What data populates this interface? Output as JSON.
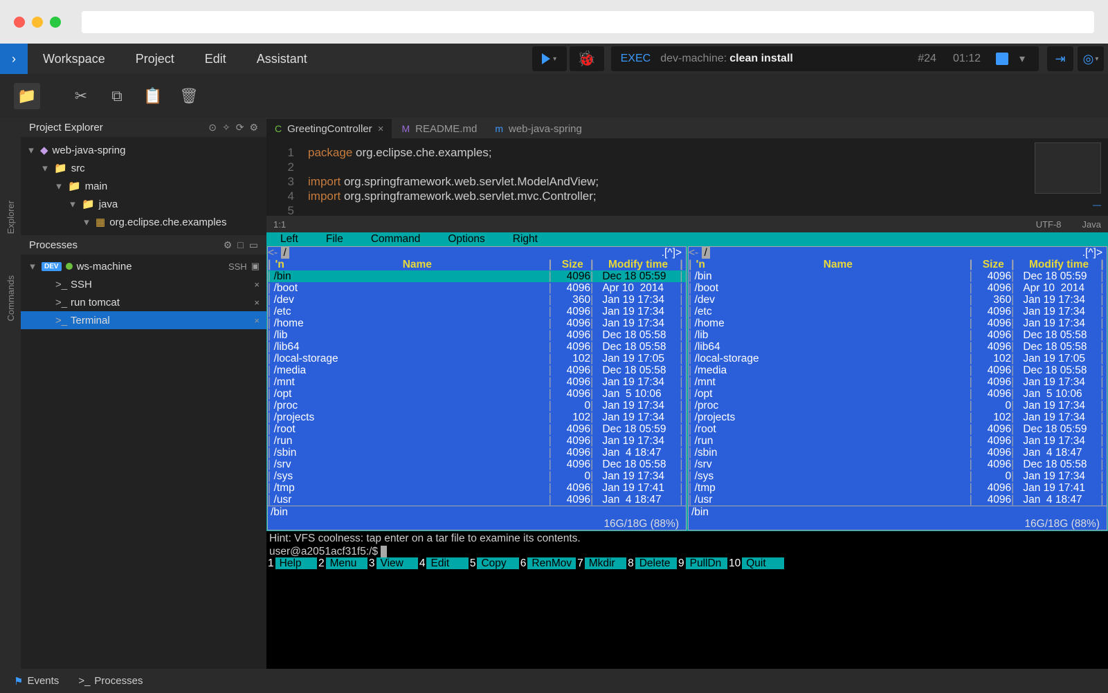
{
  "macBar": {
    "dots": [
      "#ff5f57",
      "#febc2e",
      "#28c840"
    ]
  },
  "menu": {
    "items": [
      "Workspace",
      "Project",
      "Edit",
      "Assistant"
    ]
  },
  "exec": {
    "label": "EXEC",
    "machine": "dev-machine:",
    "command": "clean install",
    "buildNumber": "#24",
    "time": "01:12"
  },
  "toolbar": {
    "buttons": [
      "new-file",
      "cut",
      "copy",
      "paste",
      "delete"
    ]
  },
  "leftRail": {
    "items": [
      "Explorer",
      "Commands"
    ]
  },
  "projectExplorer": {
    "title": "Project Explorer",
    "tree": [
      {
        "pad": 8,
        "icon": "project",
        "name": "web-java-spring"
      },
      {
        "pad": 28,
        "icon": "folder-y",
        "name": "src"
      },
      {
        "pad": 48,
        "icon": "folder-y",
        "name": "main"
      },
      {
        "pad": 68,
        "icon": "folder-b",
        "name": "java"
      },
      {
        "pad": 88,
        "icon": "package",
        "name": "org.eclipse.che.examples"
      }
    ]
  },
  "processes": {
    "title": "Processes",
    "machine": {
      "name": "ws-machine",
      "ssh": "SSH"
    },
    "items": [
      {
        "name": "SSH",
        "selected": false
      },
      {
        "name": "run tomcat",
        "selected": false
      },
      {
        "name": "Terminal",
        "selected": true
      }
    ]
  },
  "editor": {
    "tabs": [
      {
        "label": "GreetingController",
        "ico": "C",
        "icoColor": "#6dbf3f",
        "active": true,
        "close": true
      },
      {
        "label": "README.md",
        "ico": "M",
        "icoColor": "#9b6dd7",
        "active": false,
        "close": false
      },
      {
        "label": "web-java-spring",
        "ico": "m",
        "icoColor": "#3b99fc",
        "active": false,
        "close": false
      }
    ],
    "code": [
      {
        "n": 1,
        "html": "<span class='kw'>package</span> <span class='plain'>org.eclipse.che.examples;</span>"
      },
      {
        "n": 2,
        "html": ""
      },
      {
        "n": 3,
        "html": "<span class='kw'>import</span> <span class='plain'>org.springframework.web.servlet.ModelAndView;</span>"
      },
      {
        "n": 4,
        "html": "<span class='kw'>import</span> <span class='plain'>org.springframework.web.servlet.mvc.Controller;</span>"
      },
      {
        "n": 5,
        "html": ""
      }
    ],
    "status": {
      "pos": "1:1",
      "encoding": "UTF-8",
      "lang": "Java"
    }
  },
  "mc": {
    "menu": [
      "Left",
      "File",
      "Command",
      "Options",
      "Right"
    ],
    "path": "/",
    "upMark": ".[^]>",
    "header": {
      "n": "'n",
      "name": "Name",
      "size": "Size",
      "mod": "Modify time"
    },
    "rows": [
      {
        "name": "/bin",
        "size": "4096",
        "mod": "Dec 18 05:59",
        "sel": true
      },
      {
        "name": "/boot",
        "size": "4096",
        "mod": "Apr 10  2014"
      },
      {
        "name": "/dev",
        "size": "360",
        "mod": "Jan 19 17:34"
      },
      {
        "name": "/etc",
        "size": "4096",
        "mod": "Jan 19 17:34"
      },
      {
        "name": "/home",
        "size": "4096",
        "mod": "Jan 19 17:34"
      },
      {
        "name": "/lib",
        "size": "4096",
        "mod": "Dec 18 05:58"
      },
      {
        "name": "/lib64",
        "size": "4096",
        "mod": "Dec 18 05:58"
      },
      {
        "name": "/local-storage",
        "size": "102",
        "mod": "Jan 19 17:05"
      },
      {
        "name": "/media",
        "size": "4096",
        "mod": "Dec 18 05:58"
      },
      {
        "name": "/mnt",
        "size": "4096",
        "mod": "Jan 19 17:34"
      },
      {
        "name": "/opt",
        "size": "4096",
        "mod": "Jan  5 10:06"
      },
      {
        "name": "/proc",
        "size": "0",
        "mod": "Jan 19 17:34"
      },
      {
        "name": "/projects",
        "size": "102",
        "mod": "Jan 19 17:34"
      },
      {
        "name": "/root",
        "size": "4096",
        "mod": "Dec 18 05:59"
      },
      {
        "name": "/run",
        "size": "4096",
        "mod": "Jan 19 17:34"
      },
      {
        "name": "/sbin",
        "size": "4096",
        "mod": "Jan  4 18:47"
      },
      {
        "name": "/srv",
        "size": "4096",
        "mod": "Dec 18 05:58"
      },
      {
        "name": "/sys",
        "size": "0",
        "mod": "Jan 19 17:34"
      },
      {
        "name": "/tmp",
        "size": "4096",
        "mod": "Jan 19 17:41"
      },
      {
        "name": "/usr",
        "size": "4096",
        "mod": "Jan  4 18:47"
      }
    ],
    "footSel": "/bin",
    "disk": "16G/18G (88%)",
    "hint": "Hint: VFS coolness: tap enter on a tar file to examine its contents.",
    "prompt": "user@a2051acf31f5:/$",
    "fkeys": [
      {
        "n": "1",
        "l": "Help"
      },
      {
        "n": "2",
        "l": "Menu"
      },
      {
        "n": "3",
        "l": "View"
      },
      {
        "n": "4",
        "l": "Edit"
      },
      {
        "n": "5",
        "l": "Copy"
      },
      {
        "n": "6",
        "l": "RenMov"
      },
      {
        "n": "7",
        "l": "Mkdir"
      },
      {
        "n": "8",
        "l": "Delete"
      },
      {
        "n": "9",
        "l": "PullDn"
      },
      {
        "n": "10",
        "l": "Quit"
      }
    ]
  },
  "bottomBar": {
    "items": [
      {
        "ico": "⚑",
        "label": "Events",
        "color": "#3b99fc"
      },
      {
        "ico": ">_",
        "label": "Processes",
        "color": "#ccc"
      }
    ]
  }
}
